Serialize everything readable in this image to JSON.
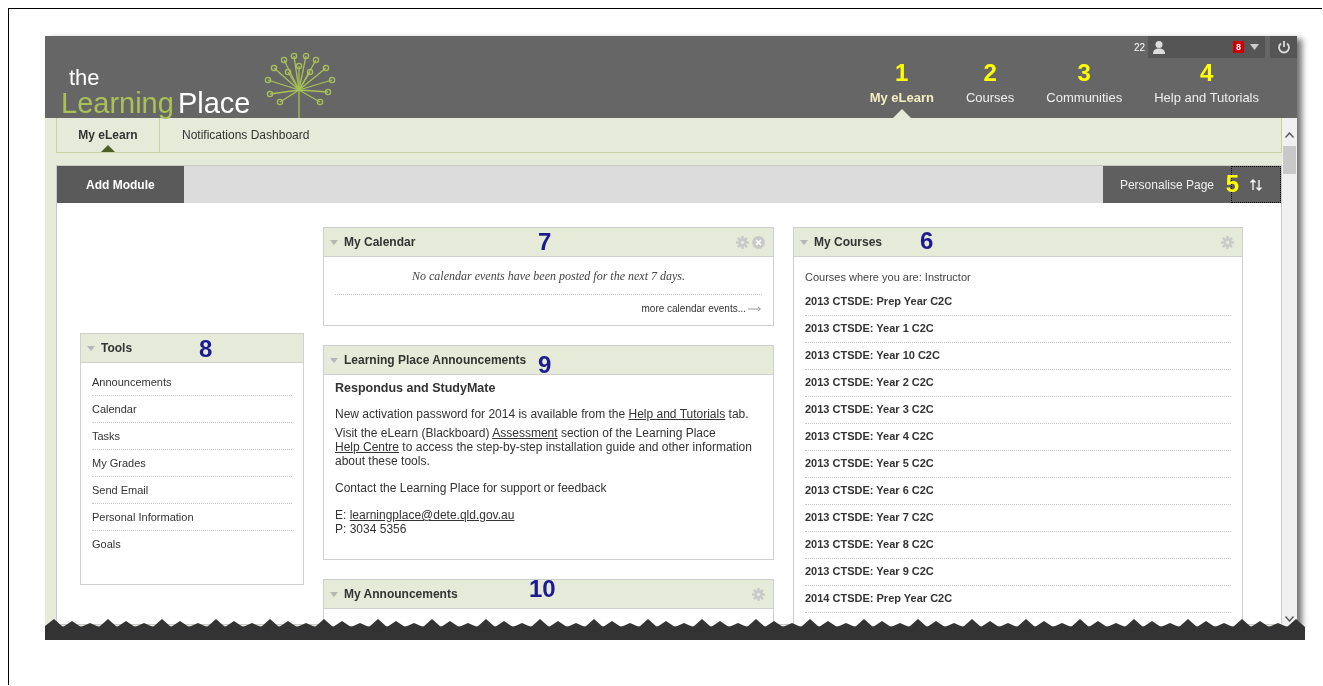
{
  "logo": {
    "small": "the",
    "first": "Learning",
    "second": "Place"
  },
  "user_bar": {
    "count": "22",
    "badge": "8"
  },
  "nav_tabs": [
    {
      "label": "My eLearn",
      "callout": "1",
      "selected": true
    },
    {
      "label": "Courses",
      "callout": "2",
      "selected": false
    },
    {
      "label": "Communities",
      "callout": "3",
      "selected": false
    },
    {
      "label": "Help and Tutorials",
      "callout": "4",
      "selected": false
    }
  ],
  "sub_tabs": [
    {
      "label": "My eLearn",
      "selected": true
    },
    {
      "label": "Notifications Dashboard",
      "selected": false
    }
  ],
  "toolbar": {
    "add_button": "Add Module",
    "personalise_button": "Personalise Page",
    "callout": "5"
  },
  "tools": {
    "title": "Tools",
    "callout": "8",
    "items": [
      "Announcements",
      "Calendar",
      "Tasks",
      "My Grades",
      "Send Email",
      "Personal Information",
      "Goals"
    ]
  },
  "calendar": {
    "title": "My Calendar",
    "callout": "7",
    "message": "No calendar events have been posted for the next 7 days.",
    "more_link": "more calendar events..."
  },
  "announcements": {
    "title": "Learning Place Announcements",
    "callout": "9",
    "heading": "Respondus and StudyMate",
    "paragraphs": [
      [
        {
          "text": "New activation password for 2014 is available from the ",
          "link": false
        },
        {
          "text": "Help and Tutorials",
          "link": true
        },
        {
          "text": " tab.",
          "link": false
        }
      ],
      [
        {
          "text": "Visit the eLearn (Blackboard) ",
          "link": false
        },
        {
          "text": "Assessment",
          "link": true
        },
        {
          "text": " section of the Learning Place ",
          "link": false
        },
        {
          "text": "Help Centre",
          "link": true
        },
        {
          "text": " to access the step-by-step installation guide and other information about these tools.",
          "link": false
        }
      ],
      [
        {
          "text": "Contact the Learning Place for support or feedback",
          "link": false
        }
      ],
      [
        {
          "text": "E: ",
          "link": false
        },
        {
          "text": "learningplace@dete.qld.gov.au",
          "link": true
        }
      ],
      [
        {
          "text": "P: 3034 5356",
          "link": false
        }
      ]
    ]
  },
  "my_announcements": {
    "title": "My Announcements",
    "callout": "10"
  },
  "courses": {
    "title": "My Courses",
    "callout": "6",
    "role_line": "Courses where you are: Instructor",
    "items": [
      "2013 CTSDE: Prep Year C2C",
      "2013 CTSDE: Year 1 C2C",
      "2013 CTSDE: Year 10 C2C",
      "2013 CTSDE: Year 2 C2C",
      "2013 CTSDE: Year 3 C2C",
      "2013 CTSDE: Year 4 C2C",
      "2013 CTSDE: Year 5 C2C",
      "2013 CTSDE: Year 6 C2C",
      "2013 CTSDE: Year 7 C2C",
      "2013 CTSDE: Year 8 C2C",
      "2013 CTSDE: Year 9 C2C",
      "2014 CTSDE: Prep Year C2C"
    ]
  }
}
